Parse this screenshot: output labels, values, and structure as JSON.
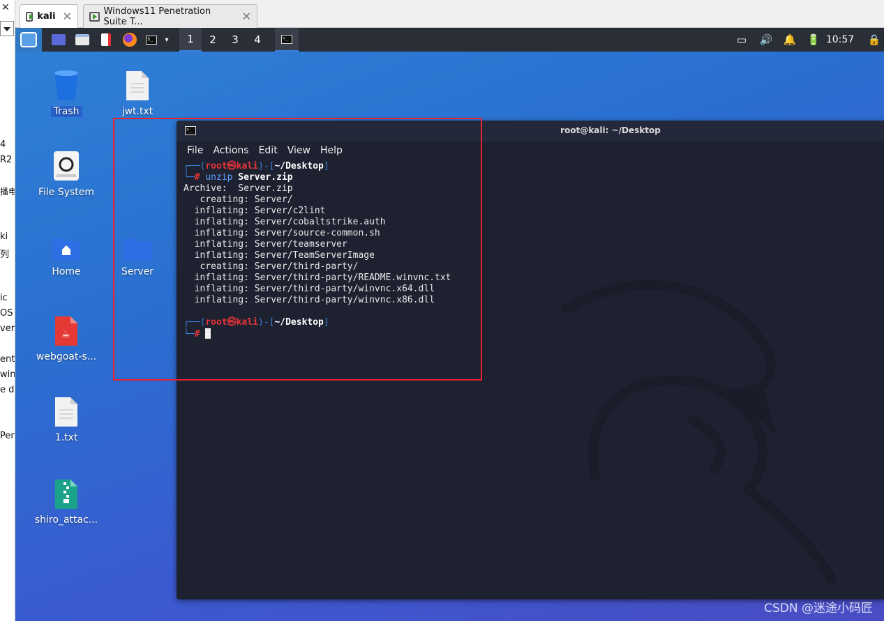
{
  "host": {
    "fragments": [
      "4",
      "R2",
      "播电",
      "ki",
      "列",
      "ic",
      "OS",
      "ver",
      "ent",
      "win",
      "e do",
      "Pen"
    ]
  },
  "tabs": [
    {
      "label": "kali"
    },
    {
      "label": "Windows11 Penetration Suite T..."
    }
  ],
  "panel": {
    "workspaces": [
      "1",
      "2",
      "3",
      "4"
    ],
    "clock": "10:57"
  },
  "desktop_icons": [
    {
      "label": "Trash"
    },
    {
      "label": "jwt.txt"
    },
    {
      "label": "File System"
    },
    {
      "label": "Home"
    },
    {
      "label": "Server"
    },
    {
      "label": "webgoat-s..."
    },
    {
      "label": "1.txt"
    },
    {
      "label": "shiro_attac..."
    }
  ],
  "terminal": {
    "title": "root@kali: ~/Desktop",
    "menu": [
      "File",
      "Actions",
      "Edit",
      "View",
      "Help"
    ],
    "prompt": {
      "user": "root",
      "at": "㉿",
      "host": "kali",
      "dir": "~/Desktop"
    },
    "command": {
      "cmd": "unzip",
      "arg": "Server.zip"
    },
    "output": [
      "Archive:  Server.zip",
      "   creating: Server/",
      "  inflating: Server/c2lint",
      "  inflating: Server/cobaltstrike.auth",
      "  inflating: Server/source-common.sh",
      "  inflating: Server/teamserver",
      "  inflating: Server/TeamServerImage",
      "   creating: Server/third-party/",
      "  inflating: Server/third-party/README.winvnc.txt",
      "  inflating: Server/third-party/winvnc.x64.dll",
      "  inflating: Server/third-party/winvnc.x86.dll"
    ]
  },
  "watermark": "CSDN @迷途小码匠",
  "colors": {
    "highlight_box": "#e8222e",
    "panel": "#2a2e37",
    "terminal_bg": "#1e2230",
    "prompt_red": "#e8333a",
    "prompt_blue": "#3c7ed8"
  }
}
